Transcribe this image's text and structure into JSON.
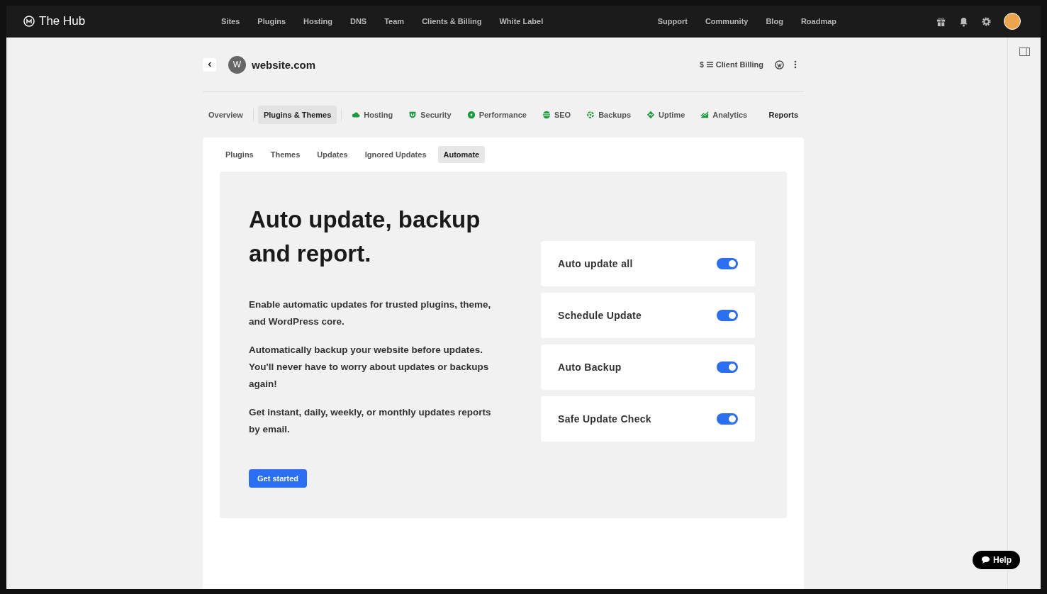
{
  "topbar": {
    "brand": "The Hub",
    "nav": [
      "Sites",
      "Plugins",
      "Hosting",
      "DNS",
      "Team",
      "Clients & Billing",
      "White Label"
    ],
    "links": [
      "Support",
      "Community",
      "Blog",
      "Roadmap"
    ]
  },
  "site": {
    "initial": "W",
    "name": "website.com",
    "billing_link": "Client Billing",
    "billing_icon": "$"
  },
  "section_tabs": [
    {
      "label": "Overview",
      "selected": false,
      "kind": "plain"
    },
    {
      "label": "Plugins & Themes",
      "selected": true,
      "kind": "plain"
    },
    {
      "label": "Hosting",
      "selected": false,
      "kind": "cloud"
    },
    {
      "label": "Security",
      "selected": false,
      "kind": "shield"
    },
    {
      "label": "Performance",
      "selected": false,
      "kind": "bolt"
    },
    {
      "label": "SEO",
      "selected": false,
      "kind": "stack"
    },
    {
      "label": "Backups",
      "selected": false,
      "kind": "backup"
    },
    {
      "label": "Uptime",
      "selected": false,
      "kind": "uptime"
    },
    {
      "label": "Analytics",
      "selected": false,
      "kind": "chart"
    },
    {
      "label": "Reports",
      "selected": false,
      "kind": "plain"
    }
  ],
  "sub_tabs": [
    {
      "label": "Plugins",
      "selected": false
    },
    {
      "label": "Themes",
      "selected": false
    },
    {
      "label": "Updates",
      "selected": false
    },
    {
      "label": "Ignored Updates",
      "selected": false
    },
    {
      "label": "Automate",
      "selected": true
    }
  ],
  "promo": {
    "heading": "Auto update, backup and report.",
    "paragraphs": [
      "Enable automatic updates for trusted plugins, theme, and WordPress core.",
      "Automatically backup your website before updates. You'll never have to worry about updates or backups again!",
      "Get instant, daily, weekly, or monthly updates reports by email."
    ],
    "button": "Get started"
  },
  "toggles": [
    {
      "label": "Auto update all",
      "on": true
    },
    {
      "label": "Schedule Update",
      "on": true
    },
    {
      "label": "Auto Backup",
      "on": true
    },
    {
      "label": "Safe Update Check",
      "on": true
    }
  ],
  "help_button": "Help"
}
